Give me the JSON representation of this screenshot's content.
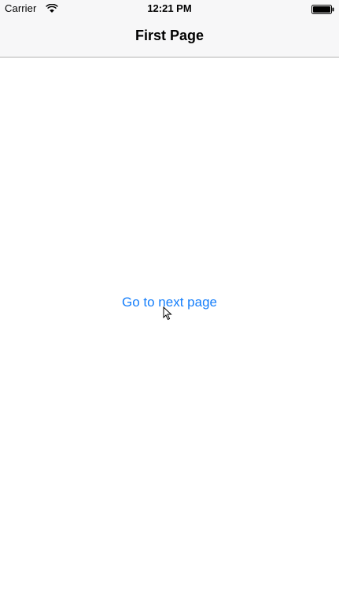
{
  "status_bar": {
    "carrier": "Carrier",
    "time": "12:21 PM",
    "wifi_icon": "wifi-icon",
    "battery_icon": "battery-icon"
  },
  "nav_bar": {
    "title": "First Page"
  },
  "main": {
    "next_button_label": "Go to next page"
  },
  "colors": {
    "tint": "#147efb",
    "nav_background": "#f7f7f8",
    "separator": "#b2b2b2"
  }
}
